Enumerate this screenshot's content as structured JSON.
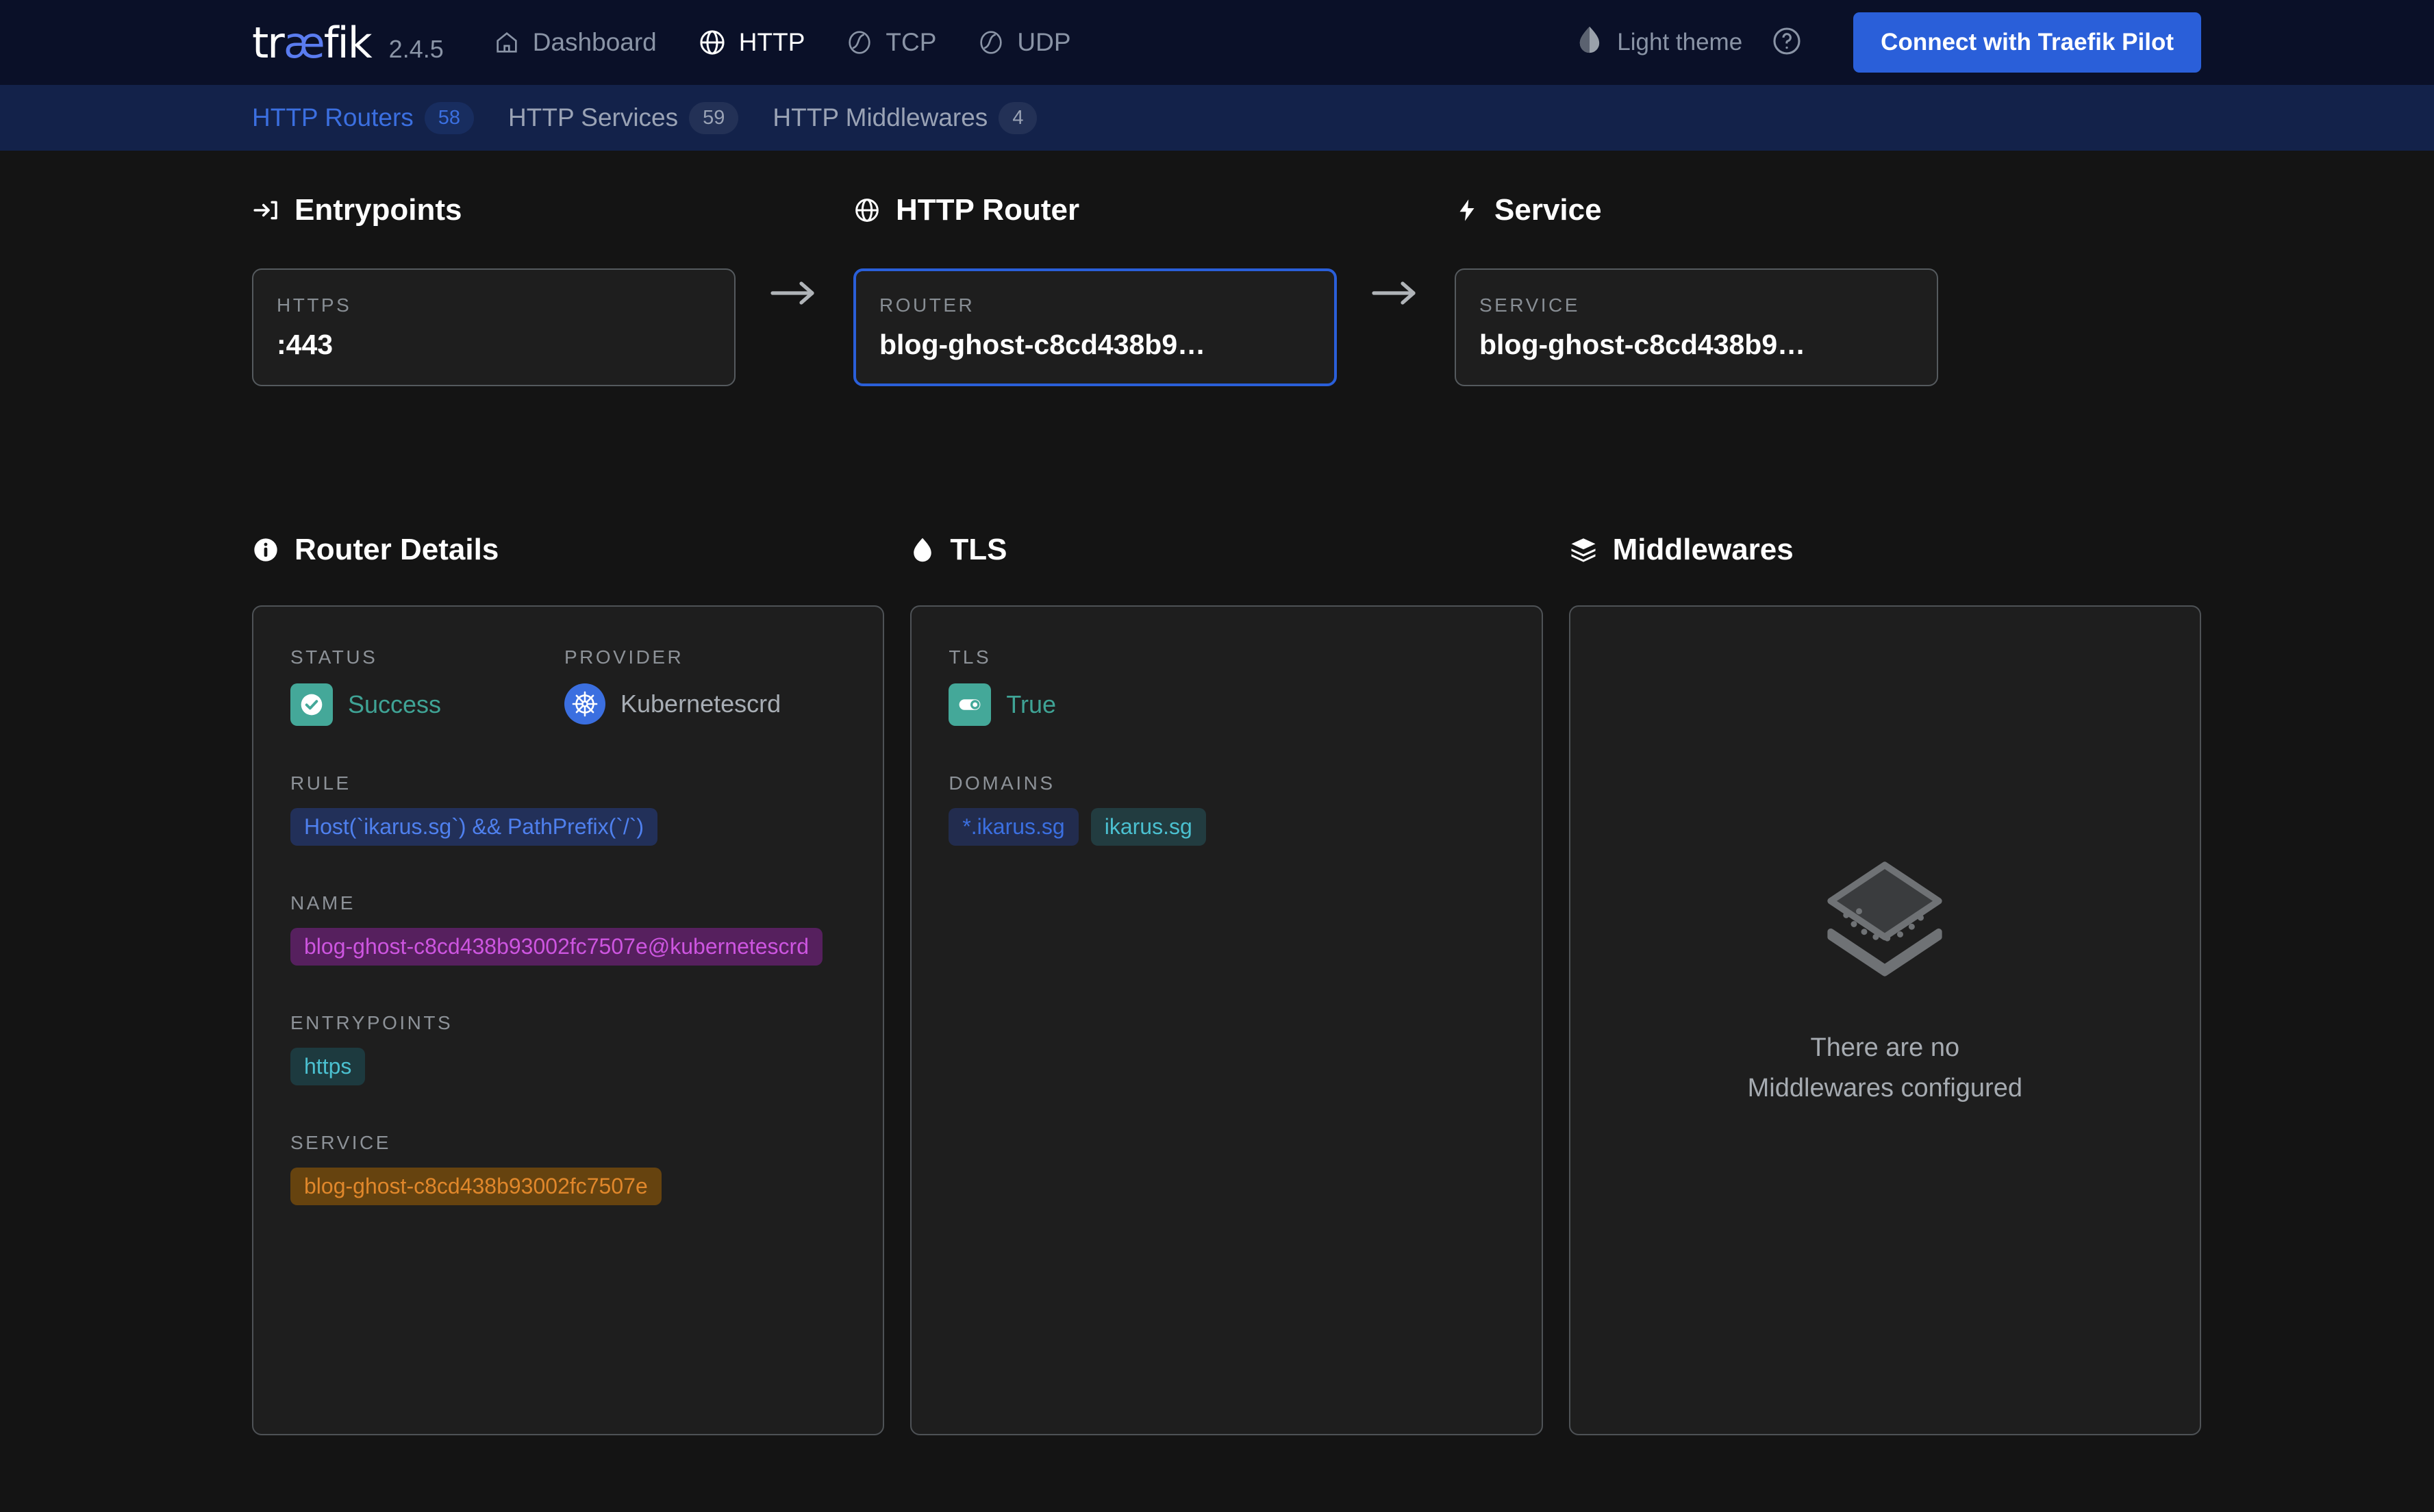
{
  "header": {
    "logo_text": "tr",
    "logo_ae": "æ",
    "logo_tail": "fik",
    "version": "2.4.5",
    "nav": [
      {
        "label": "Dashboard",
        "icon": "home-icon",
        "active": false
      },
      {
        "label": "HTTP",
        "icon": "globe-icon",
        "active": true
      },
      {
        "label": "TCP",
        "icon": "tcp-icon",
        "active": false
      },
      {
        "label": "UDP",
        "icon": "udp-icon",
        "active": false
      }
    ],
    "theme_label": "Light theme",
    "theme_icon": "half-moon-icon",
    "help_icon": "question-circle-icon",
    "pilot_button": "Connect with Traefik Pilot",
    "accent_color": "#2a5fd9",
    "background_color": "#0a1028"
  },
  "tabbar": {
    "background_color": "#13224a",
    "tabs": [
      {
        "label": "HTTP Routers",
        "count": "58",
        "active": true
      },
      {
        "label": "HTTP Services",
        "count": "59",
        "active": false
      },
      {
        "label": "HTTP Middlewares",
        "count": "4",
        "active": false
      }
    ]
  },
  "flow": {
    "entrypoints": {
      "heading": "Entrypoints",
      "icon": "arrow-into-bracket-icon",
      "card": {
        "kicker": "HTTPS",
        "value": ":443",
        "selected": false
      }
    },
    "router": {
      "heading": "HTTP Router",
      "icon": "globe-icon",
      "card": {
        "kicker": "ROUTER",
        "value": "blog-ghost-c8cd438b9…",
        "selected": true
      }
    },
    "service": {
      "heading": "Service",
      "icon": "bolt-icon",
      "card": {
        "kicker": "SERVICE",
        "value": "blog-ghost-c8cd438b9…",
        "selected": false
      }
    }
  },
  "router_details": {
    "heading": "Router Details",
    "icon": "info-icon",
    "status_label": "STATUS",
    "status_value": "Success",
    "status_icon": "check-circle-icon",
    "status_color": "#44a899",
    "provider_label": "PROVIDER",
    "provider_value": "Kubernetescrd",
    "provider_icon": "kubernetes-icon",
    "rule_label": "RULE",
    "rule_value": "Host(`ikarus.sg`) && PathPrefix(`/`)",
    "name_label": "NAME",
    "name_value": "blog-ghost-c8cd438b93002fc7507e@kubernetescrd",
    "entrypoints_label": "ENTRYPOINTS",
    "entrypoints_values": [
      "https"
    ],
    "service_label": "SERVICE",
    "service_values": [
      "blog-ghost-c8cd438b93002fc7507e"
    ]
  },
  "tls": {
    "heading": "TLS",
    "icon": "shield-icon",
    "tls_label": "TLS",
    "tls_value": "True",
    "tls_icon": "toggle-on-icon",
    "domains_label": "DOMAINS",
    "domains": [
      "*.ikarus.sg",
      "ikarus.sg"
    ]
  },
  "middlewares": {
    "heading": "Middlewares",
    "icon": "layers-icon",
    "empty_line1": "There are no",
    "empty_line2": "Middlewares configured",
    "empty_icon": "stacked-layers-icon"
  }
}
